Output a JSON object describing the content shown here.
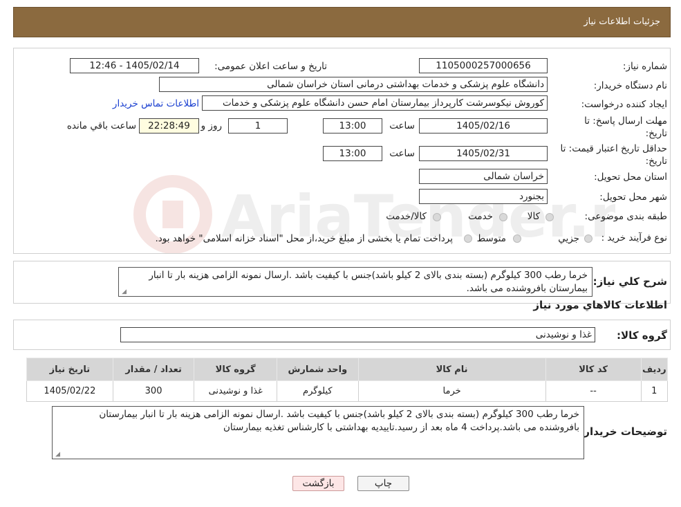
{
  "header": {
    "title": "جزئیات اطلاعات نیاز"
  },
  "form": {
    "need_number_label": "شماره نیاز:",
    "need_number": "1105000257000656",
    "announce_label": "تاریخ و ساعت اعلان عمومی:",
    "announce_value": "1405/02/14 - 12:46",
    "buyer_org_label": "نام دستگاه خریدار:",
    "buyer_org": "دانشگاه علوم پزشکی و خدمات بهداشتی درمانی استان خراسان شمالی",
    "creator_label": "ایجاد کننده درخواست:",
    "creator": "کوروش نیکوسرشت کارپرداز بیمارستان امام حسن دانشگاه علوم پزشکی و خدمات",
    "contact_link": "اطلاعات تماس خریدار",
    "deadline_label": "مهلت ارسال پاسخ: تا تاریخ:",
    "deadline_date": "1405/02/16",
    "time_label": "ساعت",
    "deadline_time": "13:00",
    "days_value": "1",
    "days_label": "روز و",
    "remaining_time": "22:28:49",
    "remaining_label": "ساعت باقي مانده",
    "min_validity_label": "حداقل تاریخ اعتبار قیمت: تا تاریخ:",
    "validity_date": "1405/02/31",
    "validity_time": "13:00",
    "province_label": "استان محل تحویل:",
    "province": "خراسان شمالی",
    "city_label": "شهر محل تحویل:",
    "city": "بجنورد",
    "category_label": "طبقه بندی موضوعی:",
    "category_options": [
      "کالا",
      "خدمت",
      "کالا/خدمت"
    ],
    "process_label": "نوع فرآیند خرید :",
    "process_options": [
      "جزیي",
      "متوسط"
    ],
    "process_note": "پرداخت تمام یا بخشی از مبلغ خرید،از محل \"اسناد خزانه اسلامی\" خواهد بود."
  },
  "description": {
    "label": "شرح کلي نياز:",
    "text": "خرما رطب 300 کیلوگرم (بسته بندی بالای 2 کیلو باشد)جنس با کیفیت باشد .ارسال نمونه الزامی هزینه بار تا انبار بیمارستان بافروشنده می باشد."
  },
  "goods_section": {
    "title": "اطلاعات کالاهاي مورد نياز"
  },
  "goods_group": {
    "label": "گروه کالا:",
    "value": "غذا و نوشیدنی"
  },
  "table": {
    "headers": [
      "رديف",
      "کد کالا",
      "نام کالا",
      "واحد شمارش",
      "گروه کالا",
      "تعداد / مقدار",
      "تاریخ نیاز"
    ],
    "rows": [
      [
        "1",
        "--",
        "خرما",
        "کیلوگرم",
        "غذا و نوشیدنی",
        "300",
        "1405/02/22"
      ]
    ]
  },
  "buyer_notes": {
    "label": "توضیحات خریدار:",
    "text": "خرما رطب 300 کیلوگرم (بسته بندی بالای 2 کیلو باشد)جنس با کیفیت باشد .ارسال نمونه الزامی هزینه بار تا انبار بیمارستان بافروشنده می باشد.پرداخت 4 ماه بعد از رسید.تاییدیه بهداشتی با کارشناس تغذیه بیمارستان"
  },
  "buttons": {
    "print": "چاپ",
    "back": "بازگشت"
  },
  "colors": {
    "header_bg": "#8b6a3f",
    "link": "#1a3fd0",
    "back_button_bg": "#fde6e6",
    "remaining_bg": "#fffde0"
  }
}
